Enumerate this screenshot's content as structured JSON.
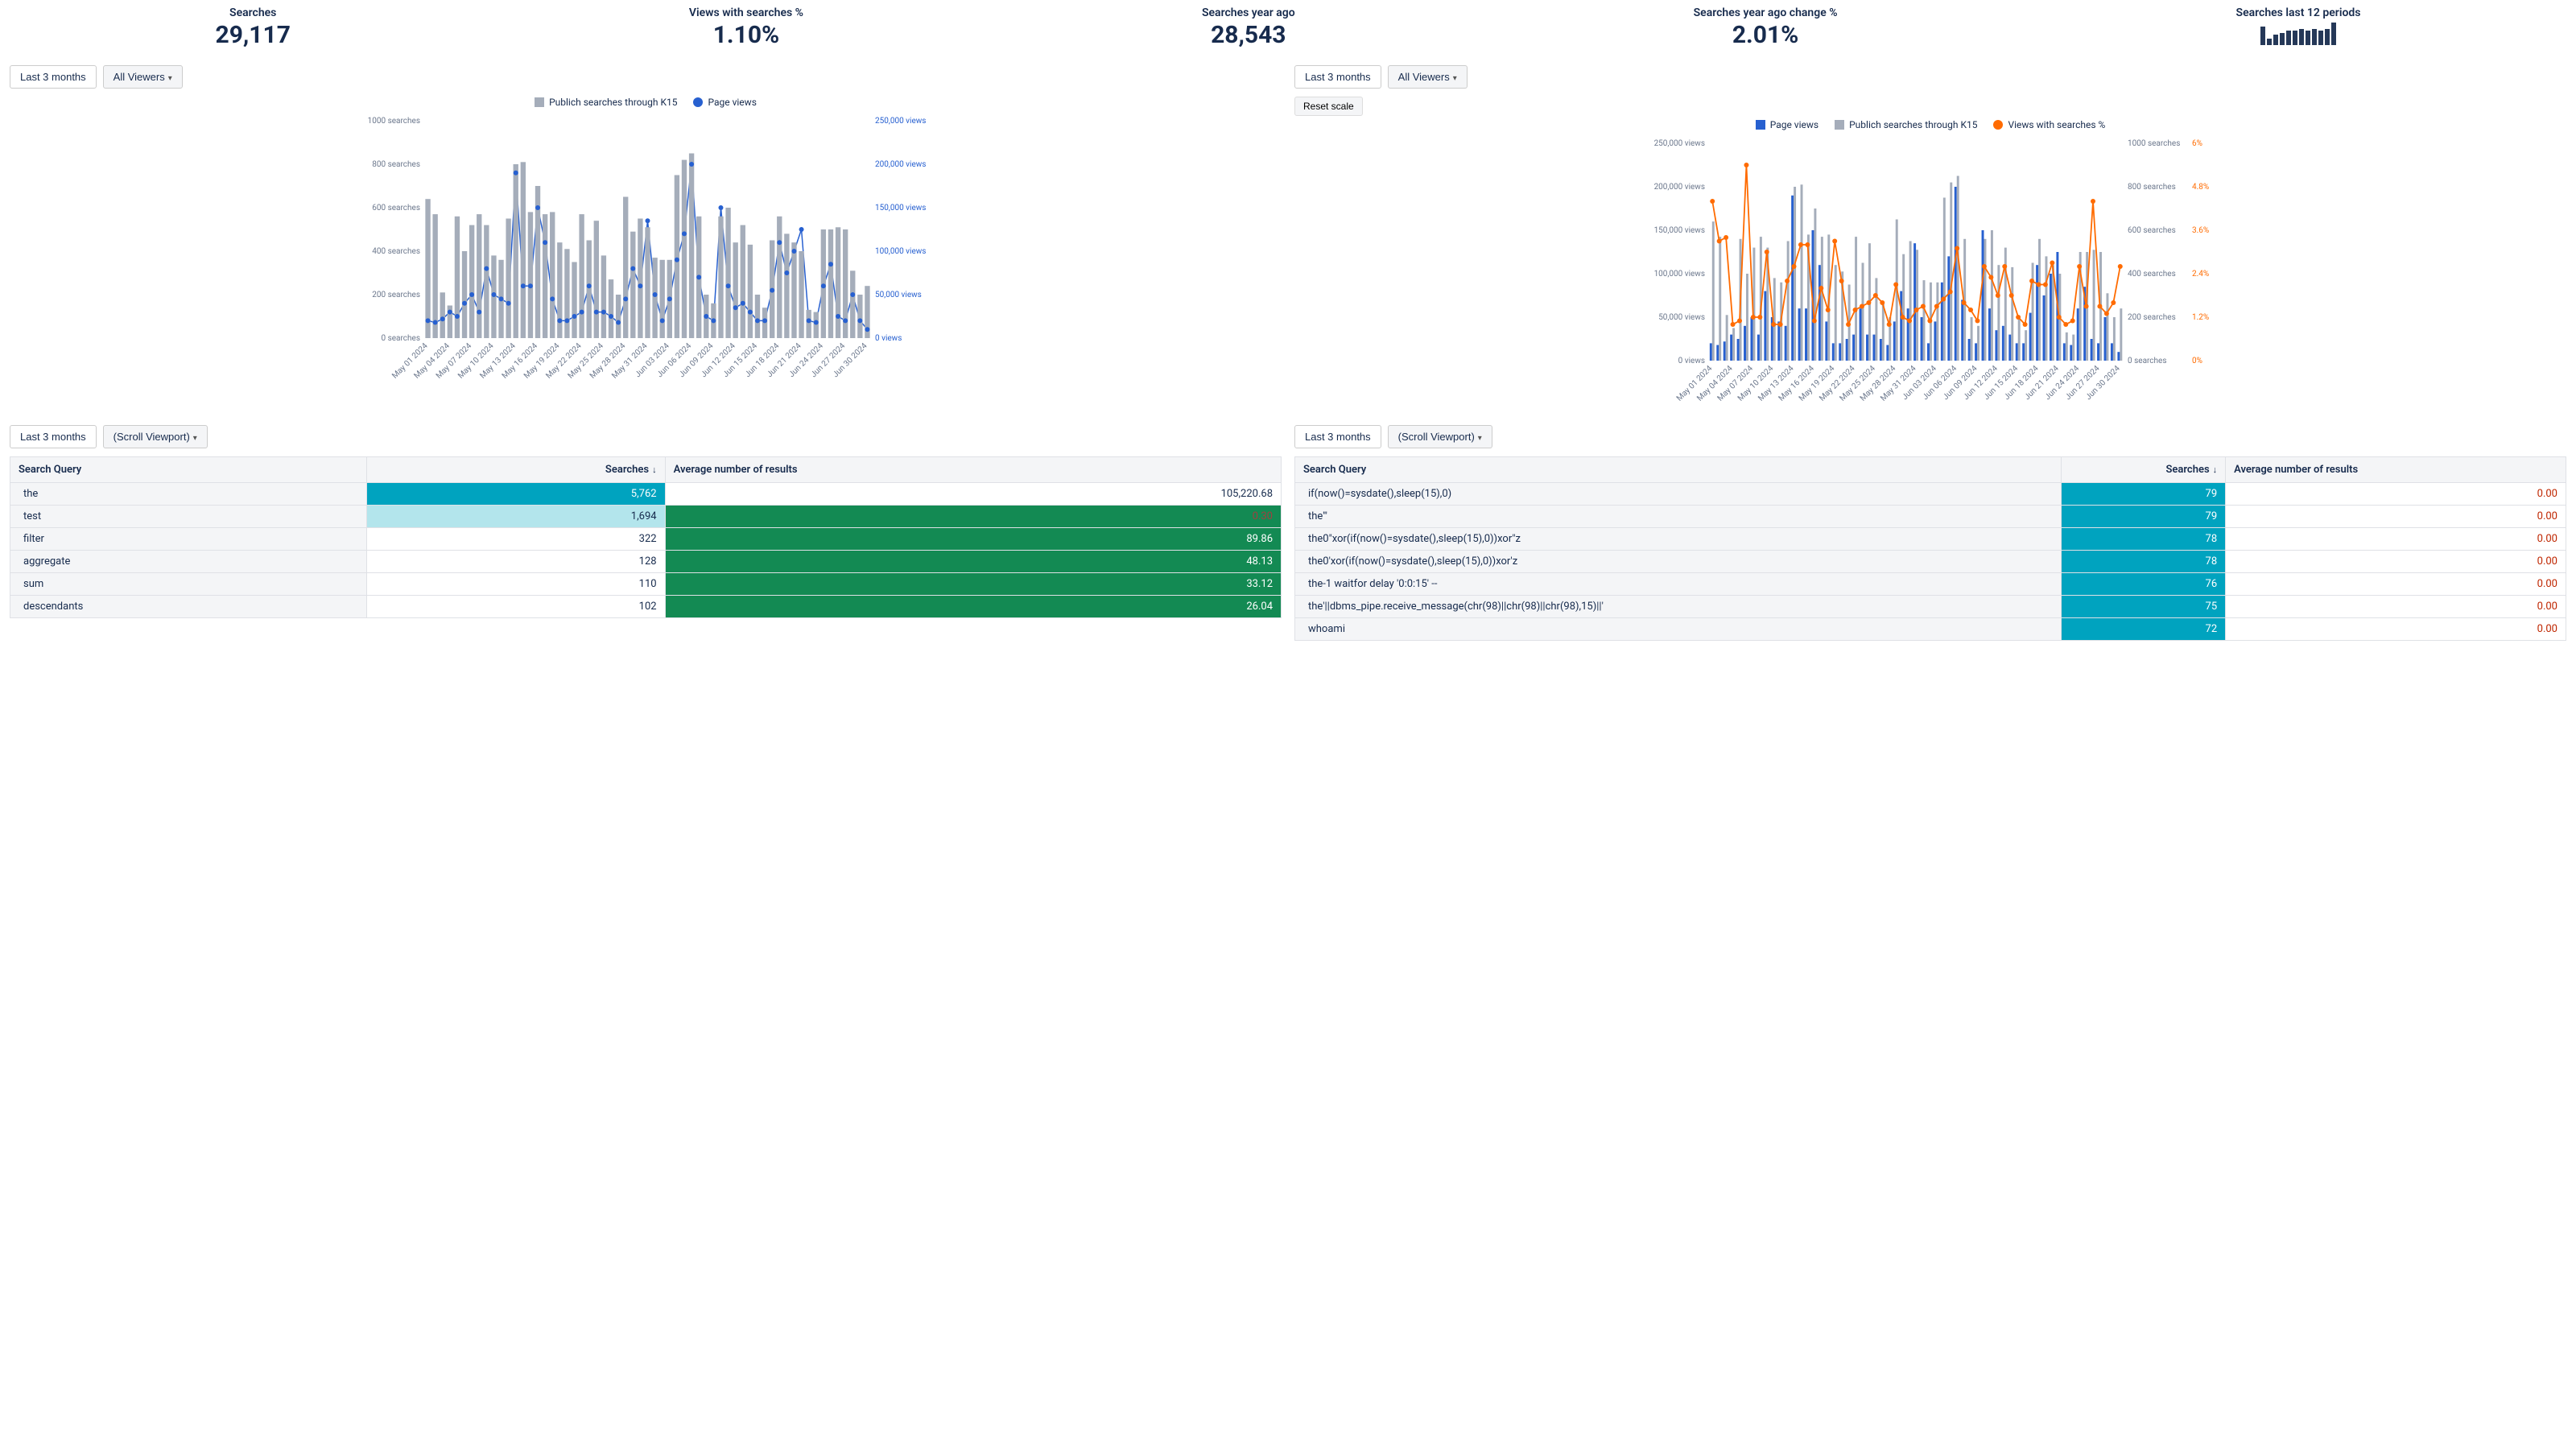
{
  "kpis": {
    "searches": {
      "label": "Searches",
      "value": "29,117"
    },
    "views_pct": {
      "label": "Views with searches %",
      "value": "1.10%"
    },
    "searches_ya": {
      "label": "Searches year ago",
      "value": "28,543"
    },
    "searches_ya_chg": {
      "label": "Searches year ago change %",
      "value": "2.01%"
    },
    "spark_label": "Searches last 12 periods",
    "spark": [
      18,
      6,
      10,
      12,
      14,
      14,
      16,
      14,
      16,
      14,
      16,
      22
    ]
  },
  "controls": {
    "range": "Last 3 months",
    "viewer": "All Viewers",
    "scroll": "(Scroll Viewport)",
    "reset": "Reset scale"
  },
  "legends": {
    "left": [
      "Publich searches through K15",
      "Page views"
    ],
    "right": [
      "Page views",
      "Publich searches through K15",
      "Views with searches %"
    ]
  },
  "chart_data": [
    {
      "type": "bar+line",
      "x": [
        "May 01 2024",
        "May 02",
        "May 03",
        "May 04 2024",
        "May 05",
        "May 06",
        "May 07 2024",
        "May 08",
        "May 09",
        "May 10 2024",
        "May 11",
        "May 12",
        "May 13 2024",
        "May 14",
        "May 15",
        "May 16 2024",
        "May 17",
        "May 18",
        "May 19 2024",
        "May 20",
        "May 21",
        "May 22 2024",
        "May 23",
        "May 24",
        "May 25 2024",
        "May 26",
        "May 27",
        "May 28 2024",
        "May 29",
        "May 30",
        "May 31 2024",
        "Jun 01",
        "Jun 02",
        "Jun 03 2024",
        "Jun 04",
        "Jun 05",
        "Jun 06 2024",
        "Jun 07",
        "Jun 08",
        "Jun 09 2024",
        "Jun 10",
        "Jun 11",
        "Jun 12 2024",
        "Jun 13",
        "Jun 14",
        "Jun 15 2024",
        "Jun 16",
        "Jun 17",
        "Jun 18 2024",
        "Jun 19",
        "Jun 20",
        "Jun 21 2024",
        "Jun 22",
        "Jun 23",
        "Jun 24 2024",
        "Jun 25",
        "Jun 26",
        "Jun 27 2024",
        "Jun 28",
        "Jun 29",
        "Jun 30 2024"
      ],
      "x_ticks": [
        "May 01 2024",
        "May 04 2024",
        "May 07 2024",
        "May 10 2024",
        "May 13 2024",
        "May 16 2024",
        "May 19 2024",
        "May 22 2024",
        "May 25 2024",
        "May 28 2024",
        "May 31 2024",
        "Jun 03 2024",
        "Jun 06 2024",
        "Jun 09 2024",
        "Jun 12 2024",
        "Jun 15 2024",
        "Jun 18 2024",
        "Jun 21 2024",
        "Jun 24 2024",
        "Jun 27 2024",
        "Jun 30 2024"
      ],
      "series": [
        {
          "name": "Publich searches through K15",
          "kind": "bar",
          "axis": "left",
          "color": "#a5adba",
          "values": [
            640,
            570,
            210,
            150,
            560,
            400,
            520,
            570,
            520,
            380,
            360,
            550,
            800,
            810,
            580,
            700,
            570,
            580,
            440,
            410,
            350,
            570,
            450,
            540,
            380,
            270,
            200,
            650,
            490,
            550,
            510,
            370,
            360,
            360,
            750,
            820,
            850,
            560,
            200,
            160,
            560,
            600,
            440,
            520,
            430,
            200,
            140,
            450,
            560,
            480,
            440,
            400,
            130,
            120,
            500,
            500,
            510,
            500,
            310,
            200,
            240
          ]
        },
        {
          "name": "Page views",
          "kind": "line",
          "axis": "right",
          "color": "#2760d0",
          "values": [
            20000,
            18000,
            22000,
            30000,
            25000,
            40000,
            50000,
            30000,
            80000,
            50000,
            45000,
            40000,
            190000,
            60000,
            60000,
            150000,
            110000,
            45000,
            20000,
            20000,
            25000,
            30000,
            60000,
            30000,
            30000,
            25000,
            18000,
            45000,
            80000,
            60000,
            135000,
            50000,
            20000,
            45000,
            90000,
            120000,
            200000,
            70000,
            25000,
            20000,
            150000,
            60000,
            35000,
            40000,
            30000,
            20000,
            20000,
            55000,
            110000,
            75000,
            100000,
            125000,
            20000,
            18000,
            60000,
            85000,
            25000,
            20000,
            50000,
            20000,
            10000
          ]
        }
      ],
      "y_left": {
        "label": "searches",
        "ticks": [
          0,
          200,
          400,
          600,
          800,
          1000
        ],
        "max": 1000
      },
      "y_right": {
        "label": "views",
        "ticks": [
          0,
          50000,
          100000,
          150000,
          200000,
          250000
        ],
        "max": 250000,
        "fmt": "comma"
      }
    },
    {
      "type": "bar+bar+line",
      "x_ticks": [
        "May 01 2024",
        "May 04 2024",
        "May 07 2024",
        "May 10 2024",
        "May 13 2024",
        "May 16 2024",
        "May 19 2024",
        "May 22 2024",
        "May 25 2024",
        "May 28 2024",
        "May 31 2024",
        "Jun 03 2024",
        "Jun 06 2024",
        "Jun 09 2024",
        "Jun 12 2024",
        "Jun 15 2024",
        "Jun 18 2024",
        "Jun 21 2024",
        "Jun 24 2024",
        "Jun 27 2024",
        "Jun 30 2024"
      ],
      "series": [
        {
          "name": "Page views",
          "kind": "bar",
          "axis": "left",
          "color": "#2760d0",
          "values": [
            20000,
            18000,
            22000,
            30000,
            25000,
            40000,
            50000,
            30000,
            80000,
            50000,
            45000,
            40000,
            190000,
            60000,
            60000,
            150000,
            110000,
            45000,
            20000,
            20000,
            25000,
            30000,
            60000,
            30000,
            30000,
            25000,
            18000,
            45000,
            80000,
            60000,
            135000,
            50000,
            20000,
            45000,
            90000,
            120000,
            200000,
            70000,
            25000,
            20000,
            150000,
            60000,
            35000,
            40000,
            30000,
            20000,
            20000,
            55000,
            110000,
            75000,
            100000,
            125000,
            20000,
            18000,
            60000,
            85000,
            25000,
            20000,
            50000,
            20000,
            10000
          ]
        },
        {
          "name": "Publich searches through K15",
          "kind": "bar",
          "axis": "right2",
          "color": "#a5adba",
          "values": [
            640,
            570,
            210,
            150,
            560,
            400,
            520,
            570,
            520,
            380,
            360,
            550,
            800,
            810,
            580,
            700,
            570,
            580,
            440,
            410,
            350,
            570,
            450,
            540,
            380,
            270,
            200,
            650,
            490,
            550,
            510,
            370,
            360,
            360,
            750,
            820,
            850,
            560,
            200,
            160,
            560,
            600,
            440,
            520,
            430,
            200,
            140,
            450,
            560,
            480,
            440,
            400,
            130,
            120,
            500,
            500,
            510,
            500,
            310,
            200,
            240
          ]
        },
        {
          "name": "Views with searches %",
          "kind": "line",
          "axis": "right3",
          "color": "#ff6b00",
          "values": [
            4.4,
            3.3,
            3.4,
            1.0,
            1.1,
            5.4,
            1.2,
            1.2,
            3.0,
            1.0,
            1.0,
            2.2,
            2.6,
            3.2,
            3.2,
            1.1,
            2.0,
            1.4,
            3.3,
            2.2,
            1.0,
            1.4,
            1.5,
            1.6,
            1.8,
            1.6,
            1.0,
            2.1,
            1.2,
            1.1,
            1.4,
            1.5,
            1.1,
            1.5,
            1.7,
            1.9,
            3.1,
            1.6,
            1.4,
            1.1,
            2.6,
            2.3,
            1.8,
            2.6,
            1.8,
            1.2,
            1.0,
            2.2,
            2.1,
            2.1,
            2.7,
            1.2,
            1.0,
            1.1,
            2.6,
            1.5,
            4.4,
            1.5,
            1.3,
            1.6,
            2.6
          ]
        }
      ],
      "y_left": {
        "label": "views",
        "ticks": [
          0,
          50000,
          100000,
          150000,
          200000,
          250000
        ],
        "max": 250000,
        "fmt": "comma"
      },
      "y_right2": {
        "label": "searches",
        "ticks": [
          0,
          200,
          400,
          600,
          800,
          1000
        ],
        "max": 1000
      },
      "y_right3": {
        "label": "%",
        "ticks": [
          0,
          1.2,
          2.4,
          3.6,
          4.8,
          6
        ],
        "max": 6
      }
    }
  ],
  "tables": {
    "left": {
      "headers": {
        "query": "Search Query",
        "searches": "Searches",
        "avg": "Average number of results"
      },
      "rows": [
        {
          "query": "the",
          "searches": "5,762",
          "avg": "105,220.68",
          "s_cls": "hl-teal",
          "a_cls": ""
        },
        {
          "query": "test",
          "searches": "1,694",
          "avg": "0.30",
          "s_cls": "hl-teal-lt",
          "a_cls": "hl-green-red"
        },
        {
          "query": "filter",
          "searches": "322",
          "avg": "89.86",
          "s_cls": "",
          "a_cls": "hl-green"
        },
        {
          "query": "aggregate",
          "searches": "128",
          "avg": "48.13",
          "s_cls": "",
          "a_cls": "hl-green"
        },
        {
          "query": "sum",
          "searches": "110",
          "avg": "33.12",
          "s_cls": "",
          "a_cls": "hl-green"
        },
        {
          "query": "descendants",
          "searches": "102",
          "avg": "26.04",
          "s_cls": "",
          "a_cls": "hl-green"
        }
      ]
    },
    "right": {
      "headers": {
        "query": "Search Query",
        "searches": "Searches",
        "avg": "Average number of results"
      },
      "rows": [
        {
          "query": "if(now()=sysdate(),sleep(15),0)",
          "searches": "79",
          "avg": "0.00",
          "s_cls": "hl-teal",
          "a_cls": "red"
        },
        {
          "query": "the'\"",
          "searches": "79",
          "avg": "0.00",
          "s_cls": "hl-teal",
          "a_cls": "red"
        },
        {
          "query": "the0\"xor(if(now()=sysdate(),sleep(15),0))xor\"z",
          "searches": "78",
          "avg": "0.00",
          "s_cls": "hl-teal",
          "a_cls": "red"
        },
        {
          "query": "the0'xor(if(now()=sysdate(),sleep(15),0))xor'z",
          "searches": "78",
          "avg": "0.00",
          "s_cls": "hl-teal",
          "a_cls": "red"
        },
        {
          "query": "the-1 waitfor delay '0:0:15' --",
          "searches": "76",
          "avg": "0.00",
          "s_cls": "hl-teal",
          "a_cls": "red"
        },
        {
          "query": "the'||dbms_pipe.receive_message(chr(98)||chr(98)||chr(98),15)||'",
          "searches": "75",
          "avg": "0.00",
          "s_cls": "hl-teal",
          "a_cls": "red"
        },
        {
          "query": "whoami",
          "searches": "72",
          "avg": "0.00",
          "s_cls": "hl-teal",
          "a_cls": "red"
        }
      ]
    }
  }
}
